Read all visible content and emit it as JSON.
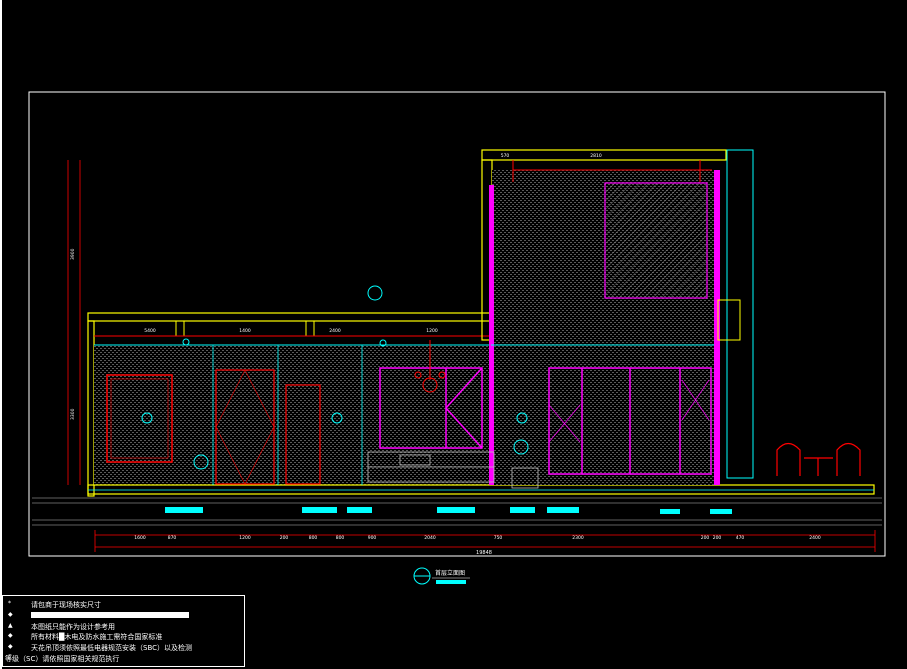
{
  "drawing": {
    "title": "首层立面图",
    "overall_dimension": "19848",
    "bottom_dimensions": [
      "1600",
      "870",
      "1200",
      "200",
      "800",
      "800",
      "900",
      "2040",
      "750",
      "2300",
      "200",
      "200",
      "470",
      "2400"
    ],
    "top_dimensions_upper": [
      "570",
      "2810"
    ],
    "top_dimensions_lower": [
      "5400",
      "1400",
      "2400",
      "1200"
    ],
    "left_dimensions": [
      "3900",
      "3300"
    ]
  },
  "notes": {
    "items": [
      {
        "bullet": "*",
        "text": "请包商于现场核实尺寸"
      },
      {
        "bullet": "◆",
        "text": ""
      },
      {
        "bullet": "▲",
        "text": "本图纸只能作为设计参考用"
      },
      {
        "bullet": "◆",
        "text": "所有材料█木电及防水施工需符合国家标准"
      },
      {
        "bullet": "◆",
        "text": "天花吊顶须依照最低电器规范安装（SBC）以及检测"
      },
      {
        "bullet": "Σ",
        "text": "等级（SC）请依照国家相关规范执行"
      }
    ]
  },
  "colors": {
    "background": "#000000",
    "frame": "#ffffff",
    "yellow": "#ffff00",
    "red": "#ff0000",
    "magenta": "#ff00ff",
    "cyan": "#00ffff",
    "grey": "#808080",
    "green": "#00ff00"
  }
}
